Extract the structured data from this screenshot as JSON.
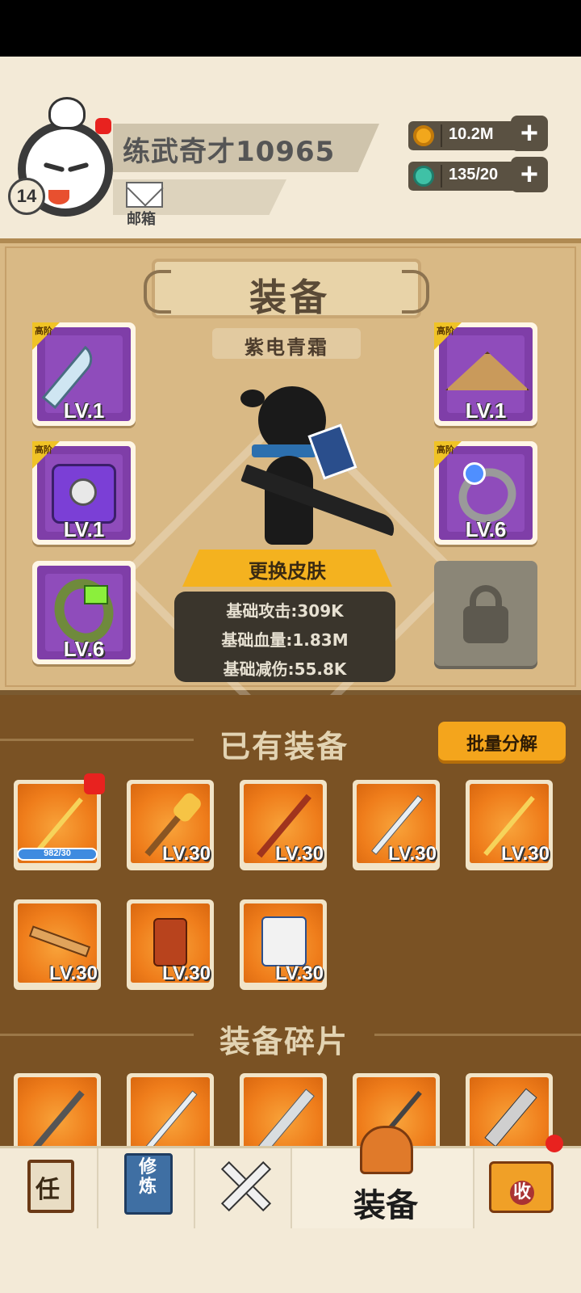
{
  "player": {
    "name": "练武奇才10965",
    "level": "14",
    "mail_label": "邮箱"
  },
  "resources": {
    "coins": "10.2M",
    "energy": "135/20"
  },
  "equipment": {
    "title": "装备",
    "skin_name": "紫电青霜",
    "tier_tag": "高阶",
    "slots": [
      {
        "name": "weapon",
        "tier": "高阶",
        "level": "LV.1"
      },
      {
        "name": "armor",
        "tier": "高阶",
        "level": "LV.1"
      },
      {
        "name": "bracelet",
        "tier": "",
        "level": "LV.6"
      },
      {
        "name": "hat",
        "tier": "高阶",
        "level": "LV.1"
      },
      {
        "name": "ring",
        "tier": "高阶",
        "level": "LV.6"
      }
    ],
    "change_skin_label": "更换皮肤",
    "stats": [
      "基础攻击:309K",
      "基础血量:1.83M",
      "基础减伤:55.8K"
    ]
  },
  "owned": {
    "title": "已有装备",
    "bulk_label": "批量分解",
    "items": [
      {
        "kind": "trident",
        "label": "982/30",
        "progress": 1.0
      },
      {
        "kind": "mace",
        "label": "LV.30"
      },
      {
        "kind": "staff",
        "label": "LV.30"
      },
      {
        "kind": "sword",
        "label": "LV.30"
      },
      {
        "kind": "spear",
        "label": "LV.30"
      },
      {
        "kind": "key-blade",
        "label": "LV.30"
      },
      {
        "kind": "red-armor",
        "label": "LV.30"
      },
      {
        "kind": "white-armor",
        "label": "LV.30"
      }
    ]
  },
  "fragments": {
    "title": "装备碎片",
    "items": [
      "mace",
      "sword",
      "saber",
      "spear",
      "claw"
    ]
  },
  "nav": {
    "tasks": "任",
    "cultivate": "修炼",
    "battle_icon": "crossed-swords-icon",
    "equipment": "装备",
    "collect": "收"
  },
  "colors": {
    "panel": "#d9b985",
    "owned_bg": "#7a5224",
    "accent": "#f4a51c",
    "badge": "#e8221f",
    "slot_purple": "#7f3ea8"
  }
}
